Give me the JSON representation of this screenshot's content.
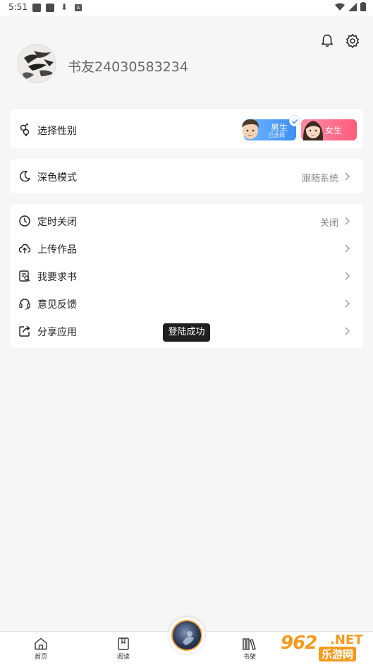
{
  "status_bar": {
    "time": "5:51",
    "a_badge": "A"
  },
  "profile": {
    "username": "书友24030583234"
  },
  "gender": {
    "label": "选择性别",
    "male_label": "男生",
    "male_sub": "已选择",
    "female_label": "女生"
  },
  "dark_mode": {
    "label": "深色模式",
    "value": "跟随系统"
  },
  "menu": {
    "timer": {
      "label": "定时关闭",
      "value": "关闭"
    },
    "upload": {
      "label": "上传作品"
    },
    "request": {
      "label": "我要求书"
    },
    "feedback": {
      "label": "意见反馈"
    },
    "share": {
      "label": "分享应用"
    }
  },
  "toast": "登陆成功",
  "bottom_nav": {
    "home": "首页",
    "read": "阅读",
    "shelf": "书架"
  },
  "watermark": {
    "number": "962",
    "net": ".NET",
    "site": "乐游网"
  },
  "colors": {
    "male": "#3f8ff5",
    "female": "#ff5d7c",
    "accent_orange": "#f59a1c"
  }
}
